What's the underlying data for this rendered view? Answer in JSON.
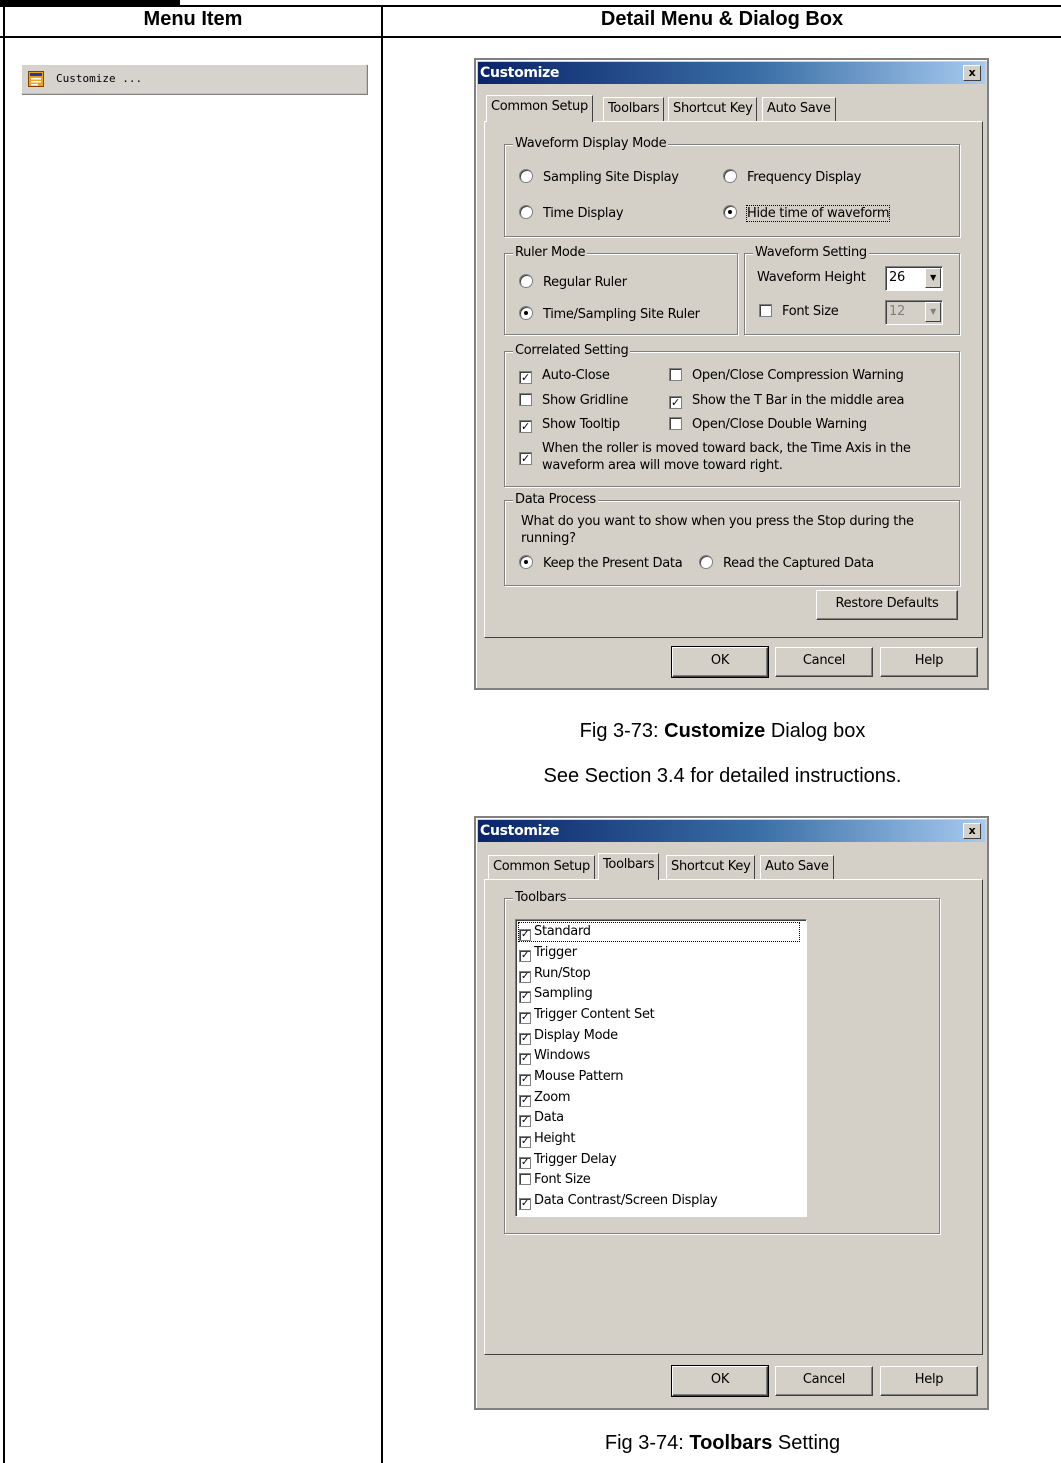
{
  "table": {
    "header_left": "Menu Item",
    "header_right": "Detail Menu & Dialog Box"
  },
  "menu_item": {
    "label": "Customize ...",
    "icon": "customize-icon"
  },
  "dialog1": {
    "title": "Customize",
    "close_label": "x",
    "tabs": [
      "Common Setup",
      "Toolbars",
      "Shortcut Key",
      "Auto Save"
    ],
    "waveform_display_mode": {
      "legend": "Waveform Display Mode",
      "sampling_site": "Sampling Site Display",
      "frequency": "Frequency Display",
      "time": "Time Display",
      "hide_time": "Hide time of waveform",
      "selected": "Hide time of waveform"
    },
    "ruler_mode": {
      "legend": "Ruler Mode",
      "regular": "Regular Ruler",
      "time_sampling": "Time/Sampling Site Ruler",
      "selected": "Time/Sampling Site Ruler"
    },
    "waveform_setting": {
      "legend": "Waveform Setting",
      "height_label": "Waveform Height",
      "height_value": "26",
      "font_size_label": "Font Size",
      "font_size_value": "12",
      "font_size_checked": false
    },
    "correlated_setting": {
      "legend": "Correlated Setting",
      "auto_close": "Auto-Close",
      "compression_warning": "Open/Close Compression Warning",
      "show_gridline": "Show Gridline",
      "t_bar": "Show the T Bar in the middle area",
      "show_tooltip": "Show Tooltip",
      "double_warning": "Open/Close Double Warning",
      "roller_line1": "When the roller is moved toward back, the Time Axis in the",
      "roller_line2": "waveform area will move toward right."
    },
    "data_process": {
      "legend": "Data Process",
      "question_line1": "What do you want to show when you press the Stop during the",
      "question_line2": "running?",
      "keep": "Keep the Present Data",
      "read": "Read the Captured Data",
      "selected": "Keep the Present Data"
    },
    "restore_defaults": "Restore Defaults",
    "ok": "OK",
    "cancel": "Cancel",
    "help": "Help"
  },
  "caption1_prefix": "Fig 3-73: ",
  "caption1_bold": "Customize",
  "caption1_suffix": " Dialog box",
  "see_section": "See Section 3.4 for detailed instructions.",
  "dialog2": {
    "title": "Customize",
    "close_label": "x",
    "tabs": [
      "Common Setup",
      "Toolbars",
      "Shortcut Key",
      "Auto Save"
    ],
    "toolbars_legend": "Toolbars",
    "items": [
      {
        "label": "Standard",
        "checked": true
      },
      {
        "label": "Trigger",
        "checked": true
      },
      {
        "label": "Run/Stop",
        "checked": true
      },
      {
        "label": "Sampling",
        "checked": true
      },
      {
        "label": "Trigger Content Set",
        "checked": true
      },
      {
        "label": "Display Mode",
        "checked": true
      },
      {
        "label": "Windows",
        "checked": true
      },
      {
        "label": "Mouse Pattern",
        "checked": true
      },
      {
        "label": "Zoom",
        "checked": true
      },
      {
        "label": "Data",
        "checked": true
      },
      {
        "label": "Height",
        "checked": true
      },
      {
        "label": "Trigger Delay",
        "checked": true
      },
      {
        "label": "Font Size",
        "checked": false
      },
      {
        "label": "Data Contrast/Screen Display",
        "checked": true
      }
    ],
    "ok": "OK",
    "cancel": "Cancel",
    "help": "Help"
  },
  "caption2_prefix": "Fig 3-74: ",
  "caption2_bold": "Toolbars",
  "caption2_suffix": " Setting"
}
